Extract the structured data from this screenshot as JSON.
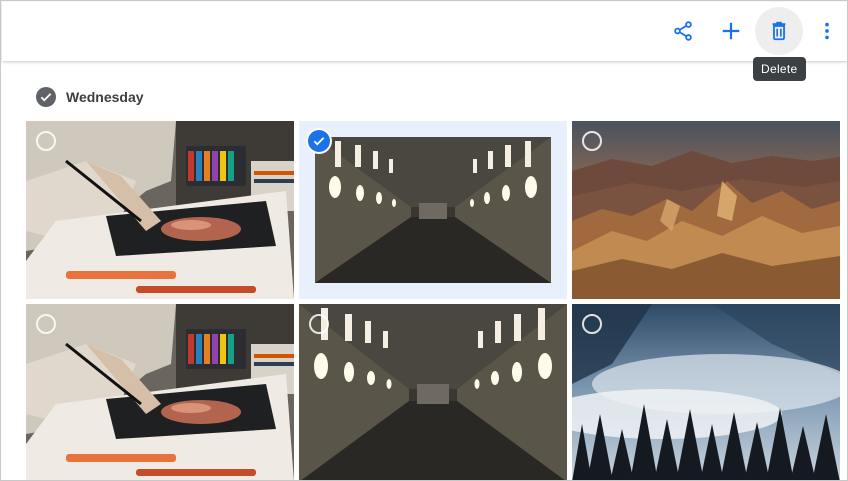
{
  "toolbar": {
    "share_icon": "share-icon",
    "add_icon": "add-icon",
    "delete_icon": "delete-icon",
    "more_icon": "more-vert-icon",
    "accent_color": "#1a73e8",
    "tooltip": "Delete"
  },
  "section": {
    "date_label": "Wednesday"
  },
  "photos": [
    {
      "subject": "drawing-desk",
      "selected": false
    },
    {
      "subject": "tunnel",
      "selected": true
    },
    {
      "subject": "desert-mountains",
      "selected": false
    },
    {
      "subject": "drawing-desk",
      "selected": false
    },
    {
      "subject": "tunnel",
      "selected": false
    },
    {
      "subject": "misty-forest",
      "selected": false
    }
  ]
}
